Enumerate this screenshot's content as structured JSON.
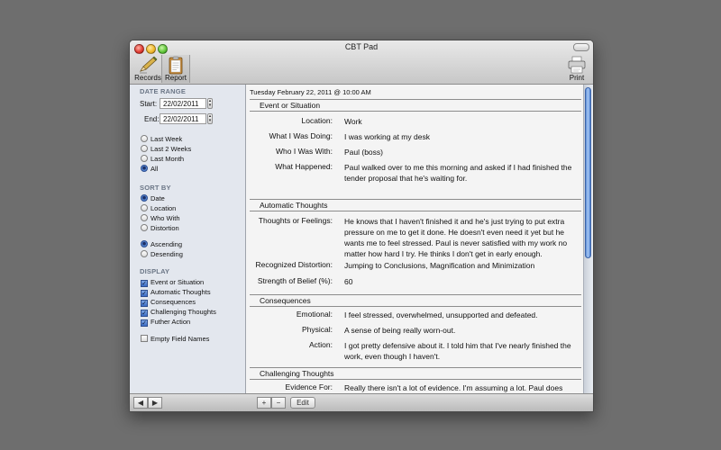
{
  "window": {
    "title": "CBT Pad"
  },
  "toolbar": {
    "records_label": "Records",
    "report_label": "Report",
    "print_label": "Print"
  },
  "sidebar": {
    "date_range": {
      "heading": "DATE RANGE",
      "start_label": "Start:",
      "start_value": "22/02/2011",
      "end_label": "End:",
      "end_value": "22/02/2011",
      "options": [
        {
          "label": "Last Week",
          "selected": false
        },
        {
          "label": "Last 2 Weeks",
          "selected": false
        },
        {
          "label": "Last Month",
          "selected": false
        },
        {
          "label": "All",
          "selected": true
        }
      ]
    },
    "sort_by": {
      "heading": "SORT BY",
      "options": [
        {
          "label": "Date",
          "selected": true
        },
        {
          "label": "Location",
          "selected": false
        },
        {
          "label": "Who With",
          "selected": false
        },
        {
          "label": "Distortion",
          "selected": false
        }
      ],
      "order": [
        {
          "label": "Ascending",
          "selected": true
        },
        {
          "label": "Desending",
          "selected": false
        }
      ]
    },
    "display": {
      "heading": "DISPLAY",
      "options": [
        {
          "label": "Event or Situation",
          "checked": true
        },
        {
          "label": "Automatic Thoughts",
          "checked": true
        },
        {
          "label": "Consequences",
          "checked": true
        },
        {
          "label": "Challenging Thoughts",
          "checked": true
        },
        {
          "label": "Futher Action",
          "checked": true
        }
      ],
      "empty_fields": {
        "label": "Empty Field Names",
        "checked": false
      }
    }
  },
  "record": {
    "date": "Tuesday February 22, 2011 @ 10:00 AM",
    "event": {
      "heading": "Event or Situation",
      "rows": [
        {
          "label": "Location:",
          "value": "Work"
        },
        {
          "label": "What I Was Doing:",
          "value": "I was working at my desk"
        },
        {
          "label": "Who I Was With:",
          "value": "Paul (boss)"
        },
        {
          "label": "What Happened:",
          "value": "Paul walked over to me this morning and asked if I had finished the tender proposal that he's waiting for."
        }
      ]
    },
    "automatic": {
      "heading": "Automatic Thoughts",
      "rows": [
        {
          "label": "Thoughts or Feelings:",
          "value": "He knows that I haven't finished it and he's just trying to put extra pressure on me to get it done. He doesn't even need it yet but he wants me to feel stressed. Paul is never satisfied with my work no matter how hard I try. He thinks I don't get in early enough."
        },
        {
          "label": "Recognized Distortion:",
          "value": "Jumping to Conclusions, Magnification and Minimization"
        },
        {
          "label": "Strength of Belief (%):",
          "value": "60"
        }
      ]
    },
    "consequences": {
      "heading": "Consequences",
      "rows": [
        {
          "label": "Emotional:",
          "value": "I feel stressed, overwhelmed, unsupported and defeated."
        },
        {
          "label": "Physical:",
          "value": "A sense of being really worn-out."
        },
        {
          "label": "Action:",
          "value": "I got pretty defensive about it. I told him that I've nearly finished the work, even though I haven't."
        }
      ]
    },
    "challenging": {
      "heading": "Challenging Thoughts",
      "rows": [
        {
          "label": "Evidence For:",
          "value": "Really there isn't a lot of evidence. I'm assuming a lot. Paul does"
        }
      ]
    }
  },
  "bottom": {
    "back_icon": "◀",
    "forward_icon": "▶",
    "add_icon": "+",
    "remove_icon": "−",
    "edit_label": "Edit"
  }
}
